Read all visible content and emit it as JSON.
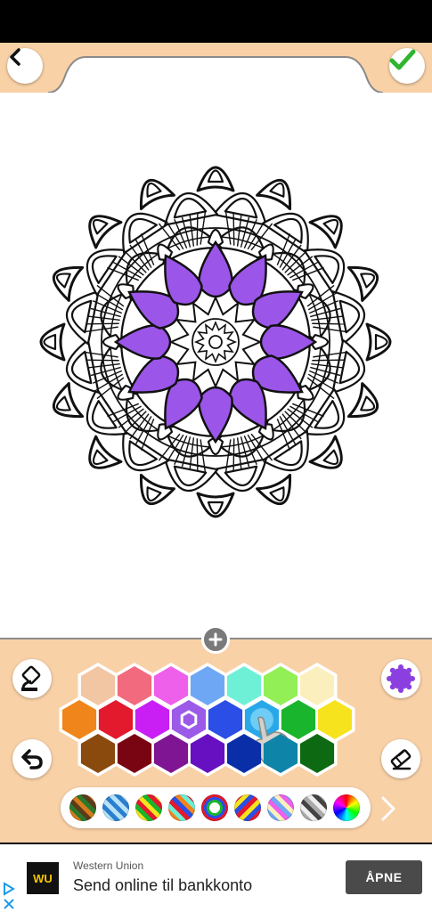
{
  "header": {
    "back_icon": "chevron-left-icon",
    "done_icon": "checkmark-icon",
    "accent_color": "#f9d1a7"
  },
  "artwork": {
    "name": "mandala",
    "filled_color": "#9b55e8"
  },
  "tools": {
    "zoom_icon": "plus-icon",
    "fill_icon": "paint-bucket-icon",
    "undo_icon": "undo-icon",
    "color_picker_icon": "gear-color-icon",
    "eraser_icon": "eraser-icon"
  },
  "palette": {
    "rows": [
      [
        "#f3c6a3",
        "#f26a7d",
        "#ee5fea",
        "#6ea8f4",
        "#6ef0d6",
        "#92ef55",
        "#fbf0bd"
      ],
      [
        "#f0851b",
        "#e3192d",
        "#c91ff5",
        "#9b5ae8",
        "#2a4ee6",
        "#28a8e8",
        "#19b52d",
        "#f6e31e"
      ],
      [
        "#8a4a0e",
        "#7a0512",
        "#7f1592",
        "#6710c2",
        "#0a2ea8",
        "#0e84a8",
        "#0d6a12"
      ]
    ],
    "selected": "#9b5ae8",
    "highlighted": "#28a8e8"
  },
  "patterns": {
    "items": [
      "striped-brown",
      "striped-blue",
      "striped-rainbow",
      "striped-multi",
      "rings-rainbow",
      "diagonal-rainbow",
      "striped-pink",
      "striped-grey",
      "color-wheel"
    ],
    "next_icon": "chevron-right-icon"
  },
  "ad": {
    "advertiser": "Western Union",
    "logo_text": "WU",
    "headline": "Send online til bankkonto",
    "cta": "ÅPNE"
  }
}
